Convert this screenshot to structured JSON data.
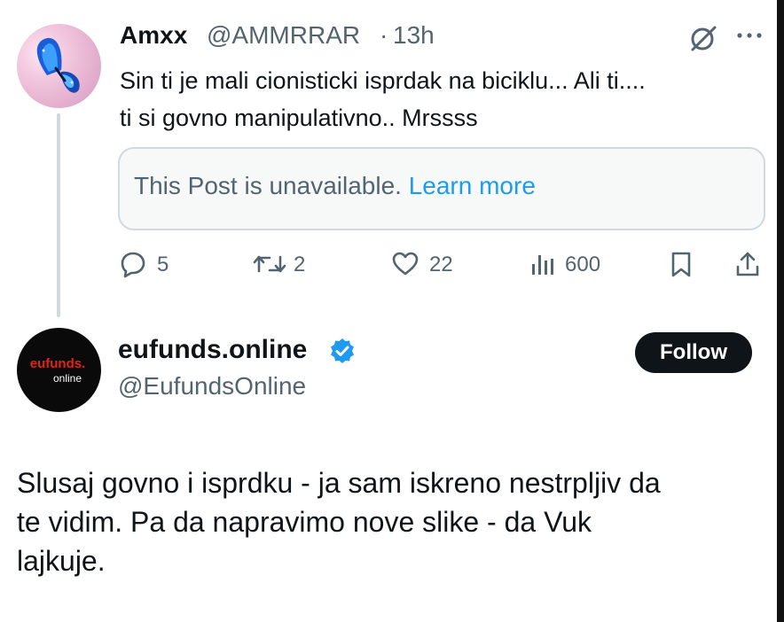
{
  "post1": {
    "display_name": "Amxx",
    "handle": "@AMMRRAR",
    "separator": "·",
    "time": "13h",
    "text": "Sin ti je mali cionisticki isprdak na biciklu... Ali ti....\nti si govno manipulativno.. Mrssss",
    "quote": {
      "message": "This Post is unavailable. ",
      "link": "Learn more"
    },
    "actions": {
      "replies": "5",
      "reposts": "2",
      "likes": "22",
      "views": "600"
    }
  },
  "post2": {
    "display_name": "eufunds.online",
    "handle": "@EufundsOnline",
    "follow_label": "Follow",
    "avatar_logo_main": "eufunds.",
    "avatar_logo_sub": "online",
    "text": "Slusaj govno i isprdku - ja sam iskreno nestrpljiv da\nte vidim. Pa da napravimo nove slike - da Vuk\nlajkuje."
  },
  "icons": [
    "grok-icon",
    "more-icon",
    "reply-icon",
    "repost-icon",
    "like-icon",
    "views-icon",
    "bookmark-icon",
    "share-icon",
    "verified-icon"
  ],
  "colors": {
    "accent": "#1d9bf0",
    "secondary_text": "#536471",
    "primary_text": "#0f1419",
    "logo_red": "#e2231a"
  }
}
